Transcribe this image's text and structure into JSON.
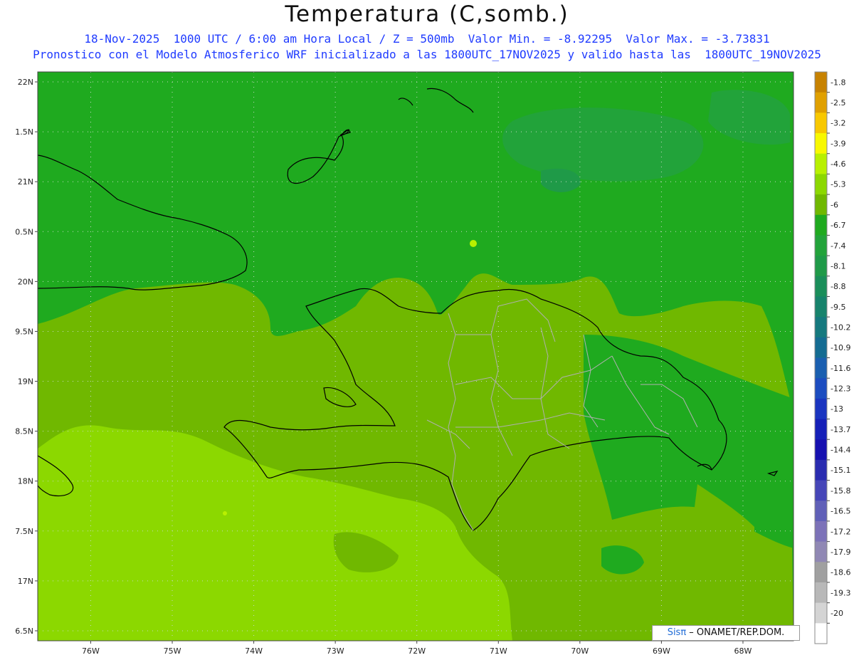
{
  "header": {
    "title": "Temperatura (C,somb.)",
    "line1": "18-Nov-2025  1000 UTC / 6:00 am Hora Local / Z = 500mb  Valor Min. = -8.92295  Valor Max. = -3.73831",
    "line2": "Pronostico con el Modelo Atmosferico WRF inicializado a las 1800UTC_17NOV2025 y valido hasta las  1800UTC_19NOV2025"
  },
  "map_data": {
    "variable": "Temperatura",
    "units": "C",
    "level_mb": 500,
    "valid": "18-Nov-2025 1000 UTC",
    "local_time": "6:00 am Hora Local",
    "value_min": -8.92295,
    "value_max": -3.73831,
    "lat_range": [
      16.4,
      22.1
    ],
    "lon_range": [
      -76.65,
      -67.38
    ],
    "lat_ticks": [
      "22N",
      "1.5N",
      "21N",
      "0.5N",
      "20N",
      "9.5N",
      "19N",
      "8.5N",
      "18N",
      "7.5N",
      "17N",
      "6.5N"
    ],
    "lat_tick_values": [
      22,
      21.5,
      21,
      20.5,
      20,
      19.5,
      19,
      18.5,
      18,
      17.5,
      17,
      16.5
    ],
    "lon_ticks": [
      "76W",
      "75W",
      "74W",
      "73W",
      "72W",
      "71W",
      "70W",
      "69W",
      "68W"
    ],
    "lon_tick_values": [
      -76,
      -75,
      -74,
      -73,
      -72,
      -71,
      -70,
      -69,
      -68
    ],
    "grid": true
  },
  "colorbar": {
    "labels": [
      "-1.8",
      "-2.5",
      "-3.2",
      "-3.9",
      "-4.6",
      "-5.3",
      "-6",
      "-6.7",
      "-7.4",
      "-8.1",
      "-8.8",
      "-9.5",
      "-10.2",
      "-10.9",
      "-11.6",
      "-12.3",
      "-13",
      "-13.7",
      "-14.4",
      "-15.1",
      "-15.8",
      "-16.5",
      "-17.2",
      "-17.9",
      "-18.6",
      "-19.3",
      "-20"
    ],
    "colors": [
      "#c78200",
      "#e0a000",
      "#f8c800",
      "#f8f800",
      "#b8f000",
      "#8cd800",
      "#70b800",
      "#1faa1f",
      "#22a33a",
      "#1f9a48",
      "#1a8e5a",
      "#17836c",
      "#15797e",
      "#146c92",
      "#1a5fb0",
      "#1c4dc0",
      "#1a35c0",
      "#1520b8",
      "#1610b0",
      "#2a2cb0",
      "#4646b8",
      "#6060b8",
      "#7c72b8",
      "#9088b4",
      "#a0a0a0",
      "#b8b8b8",
      "#d4d4d4",
      "#ffffff"
    ]
  },
  "credit": {
    "sis": "Sisπ",
    "rest": " – ONAMET/REP.DOM."
  }
}
